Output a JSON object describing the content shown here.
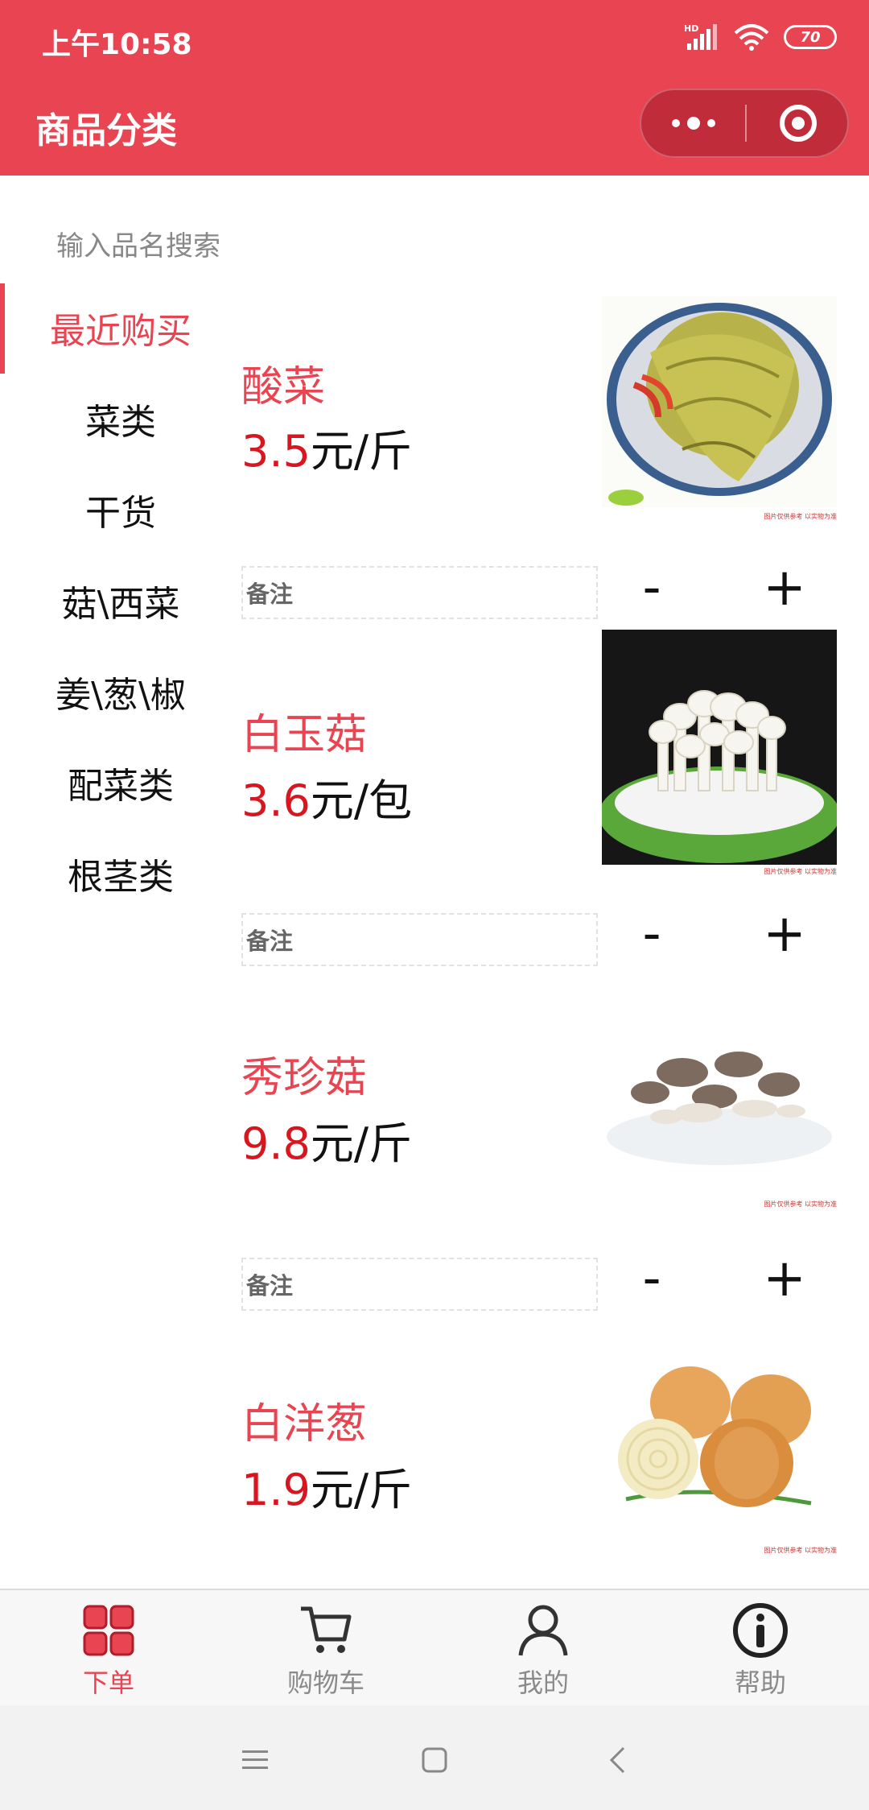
{
  "status_bar": {
    "time": "上午10:58",
    "network": "HD",
    "battery": "70"
  },
  "header": {
    "title": "商品分类",
    "more_icon": "more-dots-icon",
    "close_icon": "target-circle-icon",
    "bg_color": "#e84451"
  },
  "search": {
    "placeholder": "输入品名搜索"
  },
  "sidebar": {
    "items": [
      {
        "label": "最近购买",
        "active": true
      },
      {
        "label": "菜类"
      },
      {
        "label": "干货"
      },
      {
        "label": "菇\\西菜"
      },
      {
        "label": "姜\\葱\\椒"
      },
      {
        "label": "配菜类"
      },
      {
        "label": "根茎类"
      }
    ]
  },
  "products": [
    {
      "name": "酸菜",
      "price": "3.5",
      "unit": "元/斤",
      "remark": "备注",
      "minus": "-",
      "plus": "+",
      "image": "pickled-cabbage",
      "caption": "图片仅供参考 以实物为准"
    },
    {
      "name": "白玉菇",
      "price": "3.6",
      "unit": "元/包",
      "remark": "备注",
      "minus": "-",
      "plus": "+",
      "image": "white-mushroom",
      "caption": "图片仅供参考 以实物为准"
    },
    {
      "name": "秀珍菇",
      "price": "9.8",
      "unit": "元/斤",
      "remark": "备注",
      "minus": "-",
      "plus": "+",
      "image": "oyster-mushroom",
      "caption": "图片仅供参考 以实物为准"
    },
    {
      "name": "白洋葱",
      "price": "1.9",
      "unit": "元/斤",
      "image": "white-onion",
      "caption": "图片仅供参考 以实物为准"
    }
  ],
  "tabbar": {
    "tabs": [
      {
        "label": "下单",
        "icon": "grid-icon",
        "active": true
      },
      {
        "label": "购物车",
        "icon": "cart-icon"
      },
      {
        "label": "我的",
        "icon": "user-icon"
      },
      {
        "label": "帮助",
        "icon": "info-icon"
      }
    ]
  },
  "colors": {
    "accent": "#e84451",
    "price": "#d8161f"
  }
}
